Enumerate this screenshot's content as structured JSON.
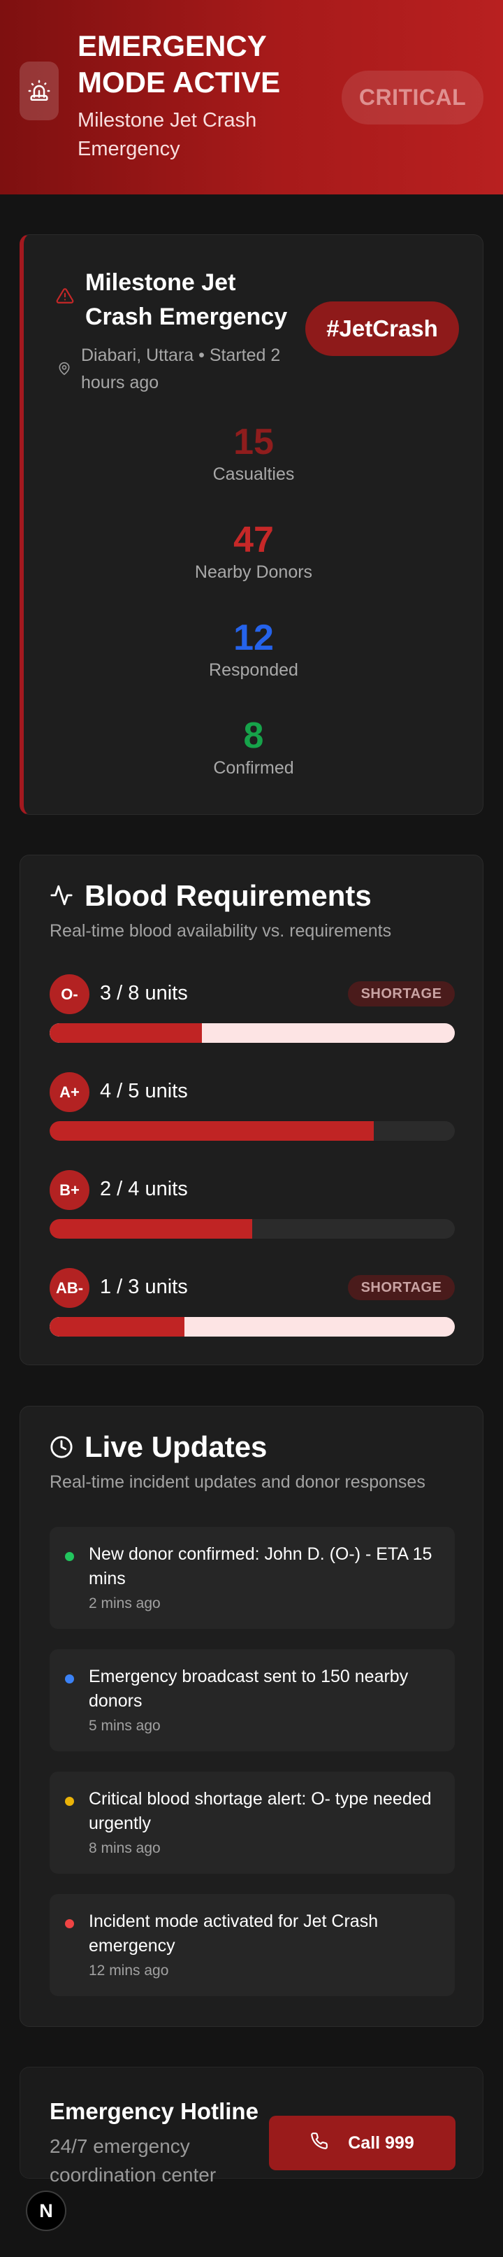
{
  "header": {
    "title": "EMERGENCY MODE ACTIVE",
    "subtitle": "Milestone Jet Crash Emergency",
    "badge": "CRITICAL",
    "icon": "siren-icon"
  },
  "incident": {
    "title": "Milestone Jet Crash Emergency",
    "location": "Diabari, Uttara • Started 2 hours ago",
    "tag": "#JetCrash",
    "stats": [
      {
        "value": "15",
        "label": "Casualties",
        "color": "#8f1d1d"
      },
      {
        "value": "47",
        "label": "Nearby Donors",
        "color": "#c62828"
      },
      {
        "value": "12",
        "label": "Responded",
        "color": "#2563eb"
      },
      {
        "value": "8",
        "label": "Confirmed",
        "color": "#16a34a"
      }
    ]
  },
  "blood": {
    "title": "Blood Requirements",
    "subtitle": "Real-time blood availability vs. requirements",
    "items": [
      {
        "type": "O-",
        "units": "3 / 8 units",
        "badge": "SHORTAGE",
        "fill": 0.375
      },
      {
        "type": "A+",
        "units": "4 / 5 units",
        "badge": "",
        "fill": 0.8
      },
      {
        "type": "B+",
        "units": "2 / 4 units",
        "badge": "",
        "fill": 0.5
      },
      {
        "type": "AB-",
        "units": "1 / 3 units",
        "badge": "SHORTAGE",
        "fill": 0.333
      }
    ]
  },
  "updates": {
    "title": "Live Updates",
    "subtitle": "Real-time incident updates and donor responses",
    "items": [
      {
        "text": "New donor confirmed: John D. (O-) - ETA 15 mins",
        "time": "2 mins ago",
        "color": "#22c55e"
      },
      {
        "text": "Emergency broadcast sent to 150 nearby donors",
        "time": "5 mins ago",
        "color": "#3b82f6"
      },
      {
        "text": "Critical blood shortage alert: O- type needed urgently",
        "time": "8 mins ago",
        "color": "#eab308"
      },
      {
        "text": "Incident mode activated for Jet Crash emergency",
        "time": "12 mins ago",
        "color": "#ef4444"
      }
    ]
  },
  "hotline": {
    "title": "Emergency Hotline",
    "subtitle": "24/7 emergency coordination center",
    "button": "Call 999"
  },
  "badge_logo": "N"
}
